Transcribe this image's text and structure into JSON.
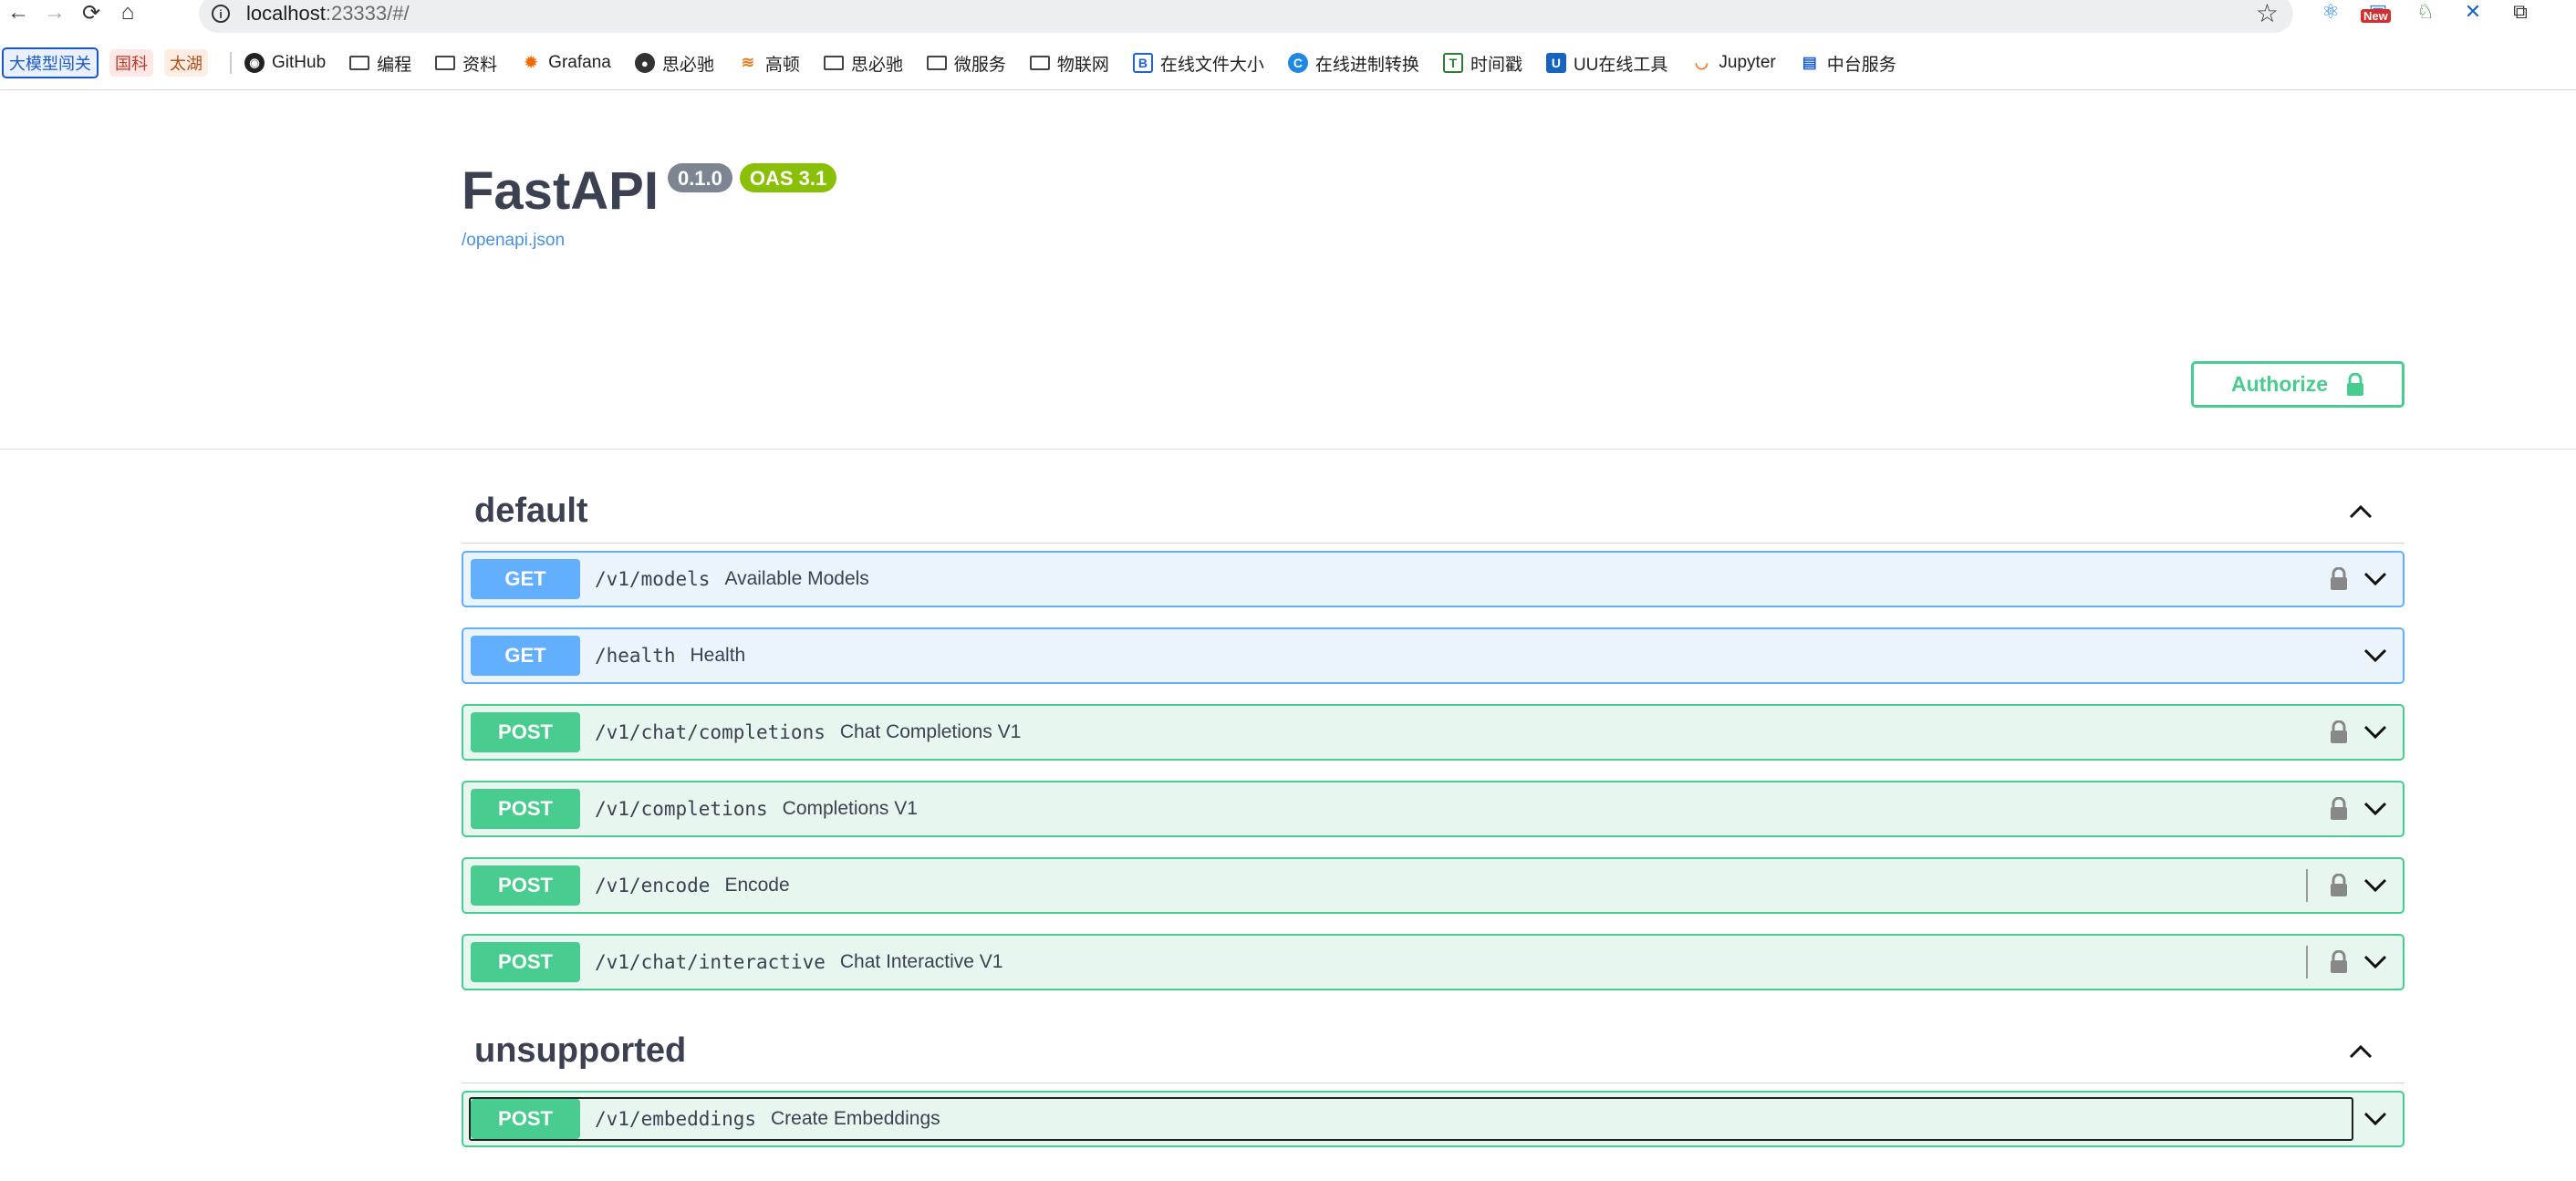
{
  "browser": {
    "url_host": "localhost",
    "url_rest": ":23333/#/",
    "ext_new_badge": "New"
  },
  "bookmarks": {
    "chips": [
      "大模型闯关",
      "国科",
      "太湖"
    ],
    "items": [
      {
        "label": "GitHub",
        "icon": "github-icon"
      },
      {
        "label": "编程",
        "icon": "folder-icon"
      },
      {
        "label": "资料",
        "icon": "folder-icon"
      },
      {
        "label": "Grafana",
        "icon": "grafana-icon"
      },
      {
        "label": "思必驰",
        "icon": "globe-icon"
      },
      {
        "label": "高顿",
        "icon": "gaodun-icon"
      },
      {
        "label": "思必驰",
        "icon": "folder-icon"
      },
      {
        "label": "微服务",
        "icon": "folder-icon"
      },
      {
        "label": "物联网",
        "icon": "folder-icon"
      },
      {
        "label": "在线文件大小",
        "icon": "b-icon"
      },
      {
        "label": "在线进制转换",
        "icon": "c-icon"
      },
      {
        "label": "时间戳",
        "icon": "t-icon"
      },
      {
        "label": "UU在线工具",
        "icon": "u-icon"
      },
      {
        "label": "Jupyter",
        "icon": "jupyter-icon"
      },
      {
        "label": "中台服务",
        "icon": "doc-icon"
      }
    ]
  },
  "info": {
    "title": "FastAPI",
    "version": "0.1.0",
    "oas": "OAS 3.1",
    "spec_link": "/openapi.json"
  },
  "authorize": {
    "label": "Authorize"
  },
  "colors": {
    "get": "#61affe",
    "post": "#49cc90",
    "get_bg": "#ebf3fb",
    "post_bg": "#e8f6f0"
  },
  "tags": [
    {
      "name": "default",
      "operations": [
        {
          "method": "GET",
          "path": "/v1/models",
          "summary": "Available Models",
          "locked": true
        },
        {
          "method": "GET",
          "path": "/health",
          "summary": "Health",
          "locked": false
        },
        {
          "method": "POST",
          "path": "/v1/chat/completions",
          "summary": "Chat Completions V1",
          "locked": true
        },
        {
          "method": "POST",
          "path": "/v1/completions",
          "summary": "Completions V1",
          "locked": true
        },
        {
          "method": "POST",
          "path": "/v1/encode",
          "summary": "Encode",
          "locked": true
        },
        {
          "method": "POST",
          "path": "/v1/chat/interactive",
          "summary": "Chat Interactive V1",
          "locked": true
        }
      ]
    },
    {
      "name": "unsupported",
      "operations": [
        {
          "method": "POST",
          "path": "/v1/embeddings",
          "summary": "Create Embeddings",
          "locked": false
        }
      ]
    }
  ]
}
